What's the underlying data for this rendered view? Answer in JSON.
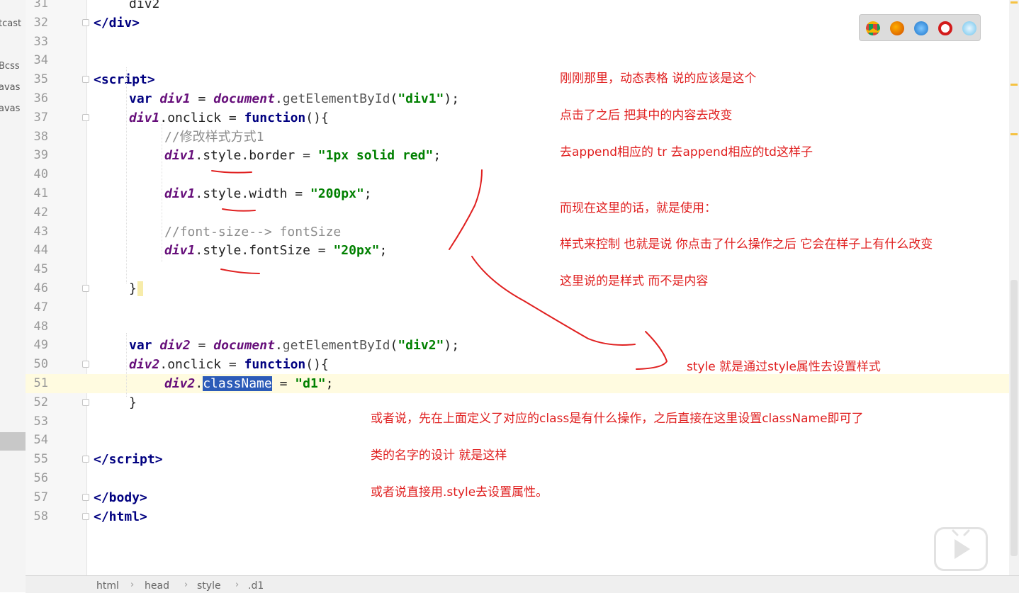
{
  "project_panel": {
    "items": [
      "tcast",
      "Bcss",
      "avas",
      "avas"
    ]
  },
  "lines": [
    {
      "n": "31",
      "html": "<span style=\"color:#222\">div2</span>"
    },
    {
      "n": "32",
      "html": "<span class=\"tag\">&lt;/div&gt;</span>"
    },
    {
      "n": "33",
      "html": ""
    },
    {
      "n": "34",
      "html": ""
    },
    {
      "n": "35",
      "html": "<span class=\"tag\">&lt;script&gt;</span>"
    },
    {
      "n": "36",
      "html": "<span class=\"kw\">var</span> <span class=\"var\">div1</span> = <span class=\"obj\">document</span>.<span class=\"fn\">getElementById</span>(<span class=\"str\">\"div1\"</span>);"
    },
    {
      "n": "37",
      "html": "<span class=\"var\">div1</span>.onclick = <span class=\"kw\">function</span>(){"
    },
    {
      "n": "38",
      "html": "<span class=\"cm\">//修改样式方式1</span>"
    },
    {
      "n": "39",
      "html": "<span class=\"var\">div1</span>.style.border = <span class=\"str\">\"1px solid red\"</span>;"
    },
    {
      "n": "40",
      "html": ""
    },
    {
      "n": "41",
      "html": "<span class=\"var\">div1</span>.style.width = <span class=\"str\">\"200px\"</span>;"
    },
    {
      "n": "42",
      "html": ""
    },
    {
      "n": "43",
      "html": "<span class=\"cm\">//font-size--&gt; fontSize</span>"
    },
    {
      "n": "44",
      "html": "<span class=\"var\">div1</span>.style.fontSize = <span class=\"str\">\"20px\"</span>;"
    },
    {
      "n": "45",
      "html": ""
    },
    {
      "n": "46",
      "html": "}"
    },
    {
      "n": "47",
      "html": ""
    },
    {
      "n": "48",
      "html": ""
    },
    {
      "n": "49",
      "html": "<span class=\"kw\">var</span> <span class=\"var\">div2</span> = <span class=\"obj\">document</span>.<span class=\"fn\">getElementById</span>(<span class=\"str\">\"div2\"</span>);"
    },
    {
      "n": "50",
      "html": "<span class=\"var\">div2</span>.onclick = <span class=\"kw\">function</span>(){"
    },
    {
      "n": "51",
      "html": "<span class=\"var\">div2</span>.<span class=\"sel\">className</span> = <span class=\"str\">\"d1\"</span>;"
    },
    {
      "n": "52",
      "html": "}"
    },
    {
      "n": "53",
      "html": ""
    },
    {
      "n": "54",
      "html": ""
    },
    {
      "n": "55",
      "html": "<span class=\"tag\">&lt;/script&gt;</span>"
    },
    {
      "n": "56",
      "html": ""
    },
    {
      "n": "57",
      "html": "<span class=\"tag\">&lt;/body&gt;</span>"
    },
    {
      "n": "58",
      "html": "<span class=\"tag\">&lt;/html&gt;</span>"
    }
  ],
  "annotations": {
    "a1": "刚刚那里，动态表格 说的应该是这个",
    "a2": "点击了之后 把其中的内容去改变",
    "a3": "去append相应的 tr  去append相应的td这样子",
    "a4": "而现在这里的话，就是使用：",
    "a5": "样式来控制  也就是说  你点击了什么操作之后 它会在样子上有什么改变",
    "a6": "这里说的是样式 而不是内容",
    "a7": "style  就是通过style属性去设置样式",
    "a8": "或者说，先在上面定义了对应的class是有什么操作，之后直接在这里设置className即可了",
    "a9": "类的名字的设计 就是这样",
    "a10": "或者说直接用.style去设置属性。"
  },
  "breadcrumb": [
    "html",
    "head",
    "style",
    ".d1"
  ],
  "browser_icons": [
    "chrome-icon",
    "firefox-icon",
    "safari-icon",
    "opera-icon",
    "ie-icon"
  ]
}
